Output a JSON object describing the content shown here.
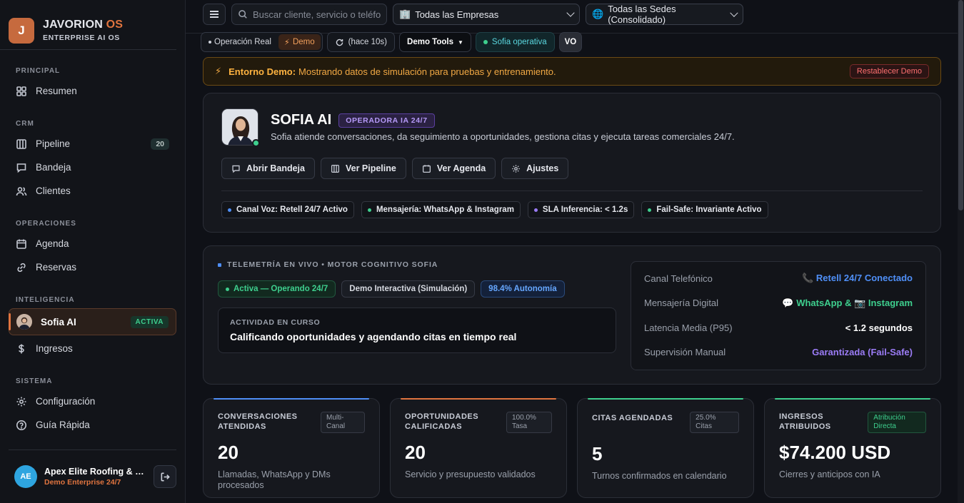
{
  "brand": {
    "logo_letter": "J",
    "name": "JAVORION",
    "name_accent": "OS",
    "subtitle": "ENTERPRISE AI OS"
  },
  "sidebar": {
    "sections": [
      {
        "title": "PRINCIPAL",
        "items": [
          {
            "label": "Resumen",
            "icon": "grid-icon"
          }
        ]
      },
      {
        "title": "CRM",
        "items": [
          {
            "label": "Pipeline",
            "icon": "columns-icon",
            "count": "20"
          },
          {
            "label": "Bandeja",
            "icon": "chat-icon"
          },
          {
            "label": "Clientes",
            "icon": "users-icon"
          }
        ]
      },
      {
        "title": "OPERACIONES",
        "items": [
          {
            "label": "Agenda",
            "icon": "calendar-icon"
          },
          {
            "label": "Reservas",
            "icon": "link-icon"
          }
        ]
      },
      {
        "title": "INTELIGENCIA",
        "items": [
          {
            "label": "Sofia AI",
            "icon": "avatar",
            "badge": "ACTIVA",
            "active": true
          },
          {
            "label": "Ingresos",
            "icon": "dollar-icon"
          }
        ]
      },
      {
        "title": "SISTEMA",
        "items": [
          {
            "label": "Configuración",
            "icon": "gear-icon"
          },
          {
            "label": "Guía Rápida",
            "icon": "help-icon"
          }
        ]
      }
    ],
    "footer": {
      "initials": "AE",
      "name": "Apex Elite Roofing & Construction",
      "plan": "Demo Enterprise 24/7"
    }
  },
  "topbar": {
    "search_placeholder": "Buscar cliente, servicio o teléfono...",
    "company_select": "Todas las Empresas",
    "site_select": "Todas las Sedes (Consolidado)"
  },
  "toolbar": {
    "mode_real": "Operación Real",
    "mode_demo": "Demo",
    "refresh": "(hace 10s)",
    "demo_tools": "Demo Tools",
    "sofia_status": "Sofia operativa",
    "user_initials": "VO"
  },
  "banner": {
    "title": "Entorno Demo:",
    "text": "Mostrando datos de simulación para pruebas y entrenamiento.",
    "reset": "Restablecer Demo"
  },
  "sofia": {
    "name": "SOFIA AI",
    "badge": "OPERADORA IA 24/7",
    "description": "Sofia atiende conversaciones, da seguimiento a oportunidades, gestiona citas y ejecuta tareas comerciales 24/7.",
    "actions": [
      {
        "label": "Abrir Bandeja",
        "icon": "chat-icon"
      },
      {
        "label": "Ver Pipeline",
        "icon": "columns-icon"
      },
      {
        "label": "Ver Agenda",
        "icon": "calendar-icon"
      },
      {
        "label": "Ajustes",
        "icon": "gear-icon"
      }
    ],
    "pills": [
      {
        "label": "Canal Voz: Retell 24/7 Activo",
        "color": "#4f8ff7"
      },
      {
        "label": "Mensajería: WhatsApp & Instagram",
        "color": "#3ecf8e"
      },
      {
        "label": "SLA Inferencia: < 1.2s",
        "color": "#9b7cf6"
      },
      {
        "label": "Fail-Safe: Invariante Activo",
        "color": "#3ecf8e"
      }
    ]
  },
  "telemetry": {
    "title": "TELEMETRÍA EN VIVO • MOTOR COGNITIVO SOFIA",
    "status": "Activa — Operando 24/7",
    "mode": "Demo Interactiva (Simulación)",
    "autonomy": "98.4% Autonomía",
    "activity_label": "ACTIVIDAD EN CURSO",
    "activity_value": "Calificando oportunidades y agendando citas en tiempo real",
    "metrics": [
      {
        "key": "Canal Telefónico",
        "value": "📞 Retell 24/7 Conectado",
        "color": "#4f8ff7"
      },
      {
        "key": "Mensajería Digital",
        "value": "💬 WhatsApp & 📷 Instagram",
        "color": "#3ecf8e"
      },
      {
        "key": "Latencia Media (P95)",
        "value": "< 1.2 segundos",
        "color": "#ffffff"
      },
      {
        "key": "Supervisión Manual",
        "value": "Garantizada (Fail-Safe)",
        "color": "#9b7cf6"
      }
    ]
  },
  "kpis": [
    {
      "label": "CONVERSACIONES ATENDIDAS",
      "tag": "Multi-Canal",
      "value": "20",
      "sub": "Llamadas, WhatsApp y DMs procesados",
      "accent": "#4f8ff7"
    },
    {
      "label": "OPORTUNIDADES CALIFICADAS",
      "tag": "100.0% Tasa",
      "value": "20",
      "sub": "Servicio y presupuesto validados",
      "accent": "#e0743f"
    },
    {
      "label": "CITAS AGENDADAS",
      "tag": "25.0% Citas",
      "value": "5",
      "sub": "Turnos confirmados en calendario",
      "accent": "#3ecf8e"
    },
    {
      "label": "INGRESOS ATRIBUIDOS",
      "tag": "Atribución Directa",
      "value": "$74.200 USD",
      "sub": "Cierres y anticipos con IA",
      "accent": "#3ecf8e"
    }
  ]
}
